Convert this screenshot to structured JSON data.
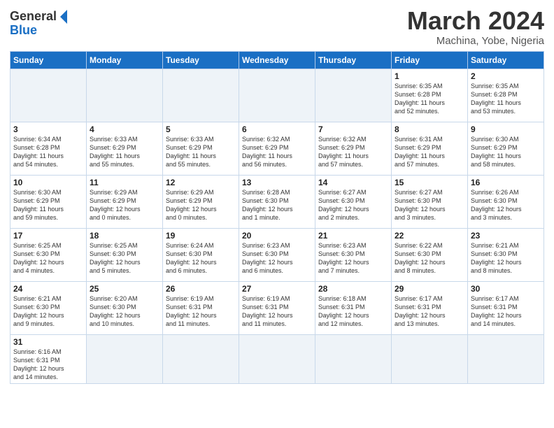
{
  "header": {
    "logo_general": "General",
    "logo_blue": "Blue",
    "month_title": "March 2024",
    "location": "Machina, Yobe, Nigeria"
  },
  "days_of_week": [
    "Sunday",
    "Monday",
    "Tuesday",
    "Wednesday",
    "Thursday",
    "Friday",
    "Saturday"
  ],
  "weeks": [
    [
      {
        "day": "",
        "info": ""
      },
      {
        "day": "",
        "info": ""
      },
      {
        "day": "",
        "info": ""
      },
      {
        "day": "",
        "info": ""
      },
      {
        "day": "",
        "info": ""
      },
      {
        "day": "1",
        "info": "Sunrise: 6:35 AM\nSunset: 6:28 PM\nDaylight: 11 hours\nand 52 minutes."
      },
      {
        "day": "2",
        "info": "Sunrise: 6:35 AM\nSunset: 6:28 PM\nDaylight: 11 hours\nand 53 minutes."
      }
    ],
    [
      {
        "day": "3",
        "info": "Sunrise: 6:34 AM\nSunset: 6:28 PM\nDaylight: 11 hours\nand 54 minutes."
      },
      {
        "day": "4",
        "info": "Sunrise: 6:33 AM\nSunset: 6:29 PM\nDaylight: 11 hours\nand 55 minutes."
      },
      {
        "day": "5",
        "info": "Sunrise: 6:33 AM\nSunset: 6:29 PM\nDaylight: 11 hours\nand 55 minutes."
      },
      {
        "day": "6",
        "info": "Sunrise: 6:32 AM\nSunset: 6:29 PM\nDaylight: 11 hours\nand 56 minutes."
      },
      {
        "day": "7",
        "info": "Sunrise: 6:32 AM\nSunset: 6:29 PM\nDaylight: 11 hours\nand 57 minutes."
      },
      {
        "day": "8",
        "info": "Sunrise: 6:31 AM\nSunset: 6:29 PM\nDaylight: 11 hours\nand 57 minutes."
      },
      {
        "day": "9",
        "info": "Sunrise: 6:30 AM\nSunset: 6:29 PM\nDaylight: 11 hours\nand 58 minutes."
      }
    ],
    [
      {
        "day": "10",
        "info": "Sunrise: 6:30 AM\nSunset: 6:29 PM\nDaylight: 11 hours\nand 59 minutes."
      },
      {
        "day": "11",
        "info": "Sunrise: 6:29 AM\nSunset: 6:29 PM\nDaylight: 12 hours\nand 0 minutes."
      },
      {
        "day": "12",
        "info": "Sunrise: 6:29 AM\nSunset: 6:29 PM\nDaylight: 12 hours\nand 0 minutes."
      },
      {
        "day": "13",
        "info": "Sunrise: 6:28 AM\nSunset: 6:30 PM\nDaylight: 12 hours\nand 1 minute."
      },
      {
        "day": "14",
        "info": "Sunrise: 6:27 AM\nSunset: 6:30 PM\nDaylight: 12 hours\nand 2 minutes."
      },
      {
        "day": "15",
        "info": "Sunrise: 6:27 AM\nSunset: 6:30 PM\nDaylight: 12 hours\nand 3 minutes."
      },
      {
        "day": "16",
        "info": "Sunrise: 6:26 AM\nSunset: 6:30 PM\nDaylight: 12 hours\nand 3 minutes."
      }
    ],
    [
      {
        "day": "17",
        "info": "Sunrise: 6:25 AM\nSunset: 6:30 PM\nDaylight: 12 hours\nand 4 minutes."
      },
      {
        "day": "18",
        "info": "Sunrise: 6:25 AM\nSunset: 6:30 PM\nDaylight: 12 hours\nand 5 minutes."
      },
      {
        "day": "19",
        "info": "Sunrise: 6:24 AM\nSunset: 6:30 PM\nDaylight: 12 hours\nand 6 minutes."
      },
      {
        "day": "20",
        "info": "Sunrise: 6:23 AM\nSunset: 6:30 PM\nDaylight: 12 hours\nand 6 minutes."
      },
      {
        "day": "21",
        "info": "Sunrise: 6:23 AM\nSunset: 6:30 PM\nDaylight: 12 hours\nand 7 minutes."
      },
      {
        "day": "22",
        "info": "Sunrise: 6:22 AM\nSunset: 6:30 PM\nDaylight: 12 hours\nand 8 minutes."
      },
      {
        "day": "23",
        "info": "Sunrise: 6:21 AM\nSunset: 6:30 PM\nDaylight: 12 hours\nand 8 minutes."
      }
    ],
    [
      {
        "day": "24",
        "info": "Sunrise: 6:21 AM\nSunset: 6:30 PM\nDaylight: 12 hours\nand 9 minutes."
      },
      {
        "day": "25",
        "info": "Sunrise: 6:20 AM\nSunset: 6:30 PM\nDaylight: 12 hours\nand 10 minutes."
      },
      {
        "day": "26",
        "info": "Sunrise: 6:19 AM\nSunset: 6:31 PM\nDaylight: 12 hours\nand 11 minutes."
      },
      {
        "day": "27",
        "info": "Sunrise: 6:19 AM\nSunset: 6:31 PM\nDaylight: 12 hours\nand 11 minutes."
      },
      {
        "day": "28",
        "info": "Sunrise: 6:18 AM\nSunset: 6:31 PM\nDaylight: 12 hours\nand 12 minutes."
      },
      {
        "day": "29",
        "info": "Sunrise: 6:17 AM\nSunset: 6:31 PM\nDaylight: 12 hours\nand 13 minutes."
      },
      {
        "day": "30",
        "info": "Sunrise: 6:17 AM\nSunset: 6:31 PM\nDaylight: 12 hours\nand 14 minutes."
      }
    ],
    [
      {
        "day": "31",
        "info": "Sunrise: 6:16 AM\nSunset: 6:31 PM\nDaylight: 12 hours\nand 14 minutes."
      },
      {
        "day": "",
        "info": ""
      },
      {
        "day": "",
        "info": ""
      },
      {
        "day": "",
        "info": ""
      },
      {
        "day": "",
        "info": ""
      },
      {
        "day": "",
        "info": ""
      },
      {
        "day": "",
        "info": ""
      }
    ]
  ]
}
